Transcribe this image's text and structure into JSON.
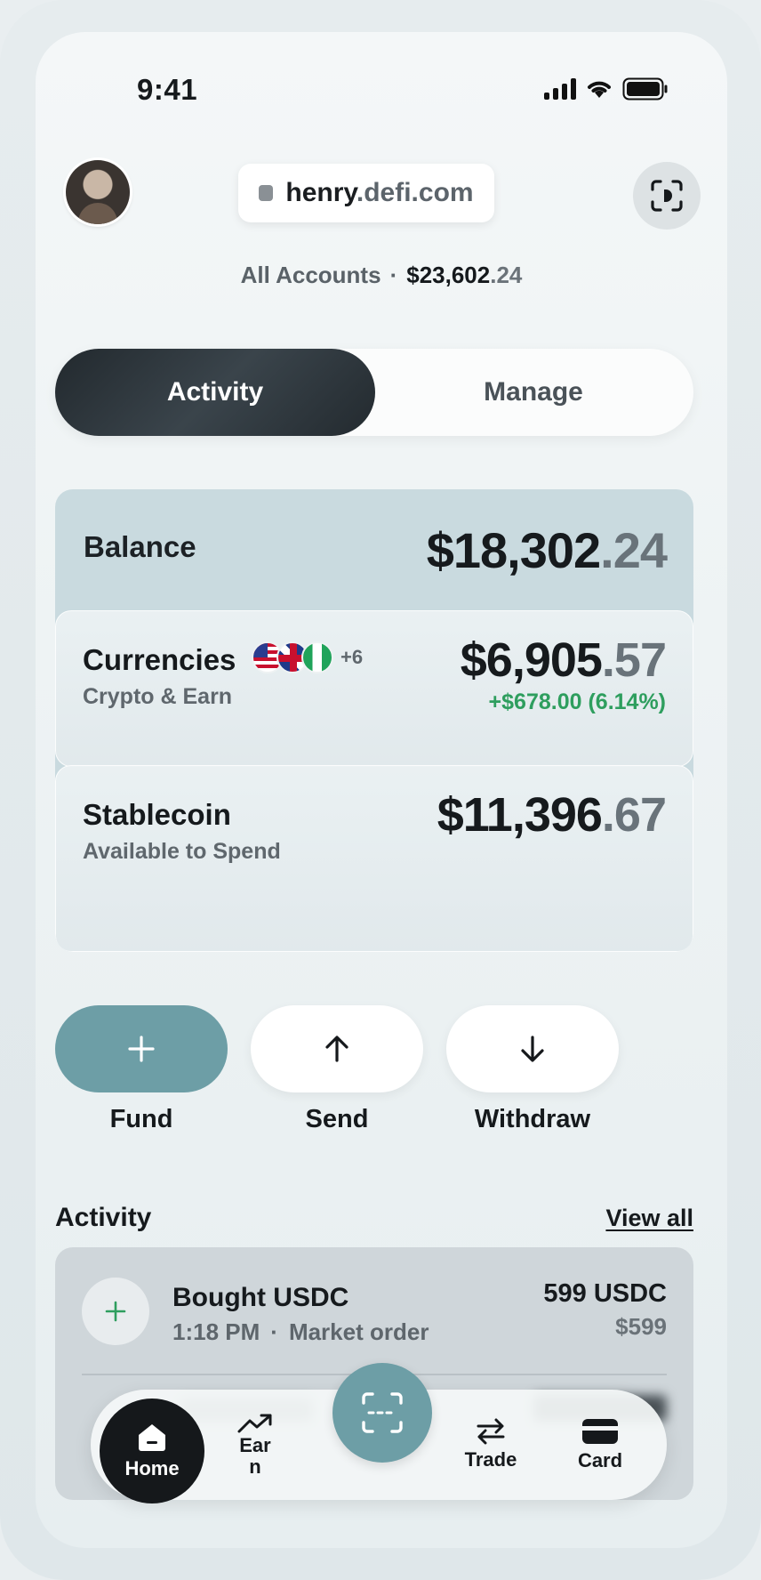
{
  "status_bar": {
    "time": "9:41"
  },
  "header": {
    "url_main": "henry",
    "url_dim": ".defi.com",
    "accounts_label": "All Accounts",
    "accounts_total_main": "$23,602",
    "accounts_total_cents": ".24"
  },
  "tabs": [
    {
      "label": "Activity",
      "active": true
    },
    {
      "label": "Manage",
      "active": false
    }
  ],
  "balance": {
    "label": "Balance",
    "amount_main": "$18,302",
    "amount_cents": ".24",
    "currencies": {
      "title": "Currencies",
      "subtitle": "Crypto & Earn",
      "amount_main": "$6,905",
      "amount_cents": ".57",
      "change": "+$678.00 (6.14%)",
      "flags": [
        "us-flag-icon",
        "uk-flag-icon",
        "nigeria-flag-icon"
      ],
      "more_flags": "+6"
    },
    "stablecoin": {
      "title": "Stablecoin",
      "subtitle": "Available to Spend",
      "amount_main": "$11,396",
      "amount_cents": ".67"
    }
  },
  "actions": [
    {
      "label": "Fund",
      "icon": "plus-icon"
    },
    {
      "label": "Send",
      "icon": "arrow-up-icon"
    },
    {
      "label": "Withdraw",
      "icon": "arrow-down-icon"
    }
  ],
  "activity": {
    "title": "Activity",
    "view_all": "View all",
    "items": [
      {
        "name": "Bought USDC",
        "time": "1:18 PM",
        "type": "Market order",
        "amount": "599 USDC",
        "usd": "$599",
        "icon": "plus-icon"
      }
    ]
  },
  "nav": {
    "home": "Home",
    "earn_line1": "Ear",
    "earn_line2": "n",
    "trade": "Trade",
    "card": "Card"
  },
  "colors": {
    "accent": "#6d9ea6",
    "positive": "#2e9e5e",
    "dark": "#15181b"
  }
}
